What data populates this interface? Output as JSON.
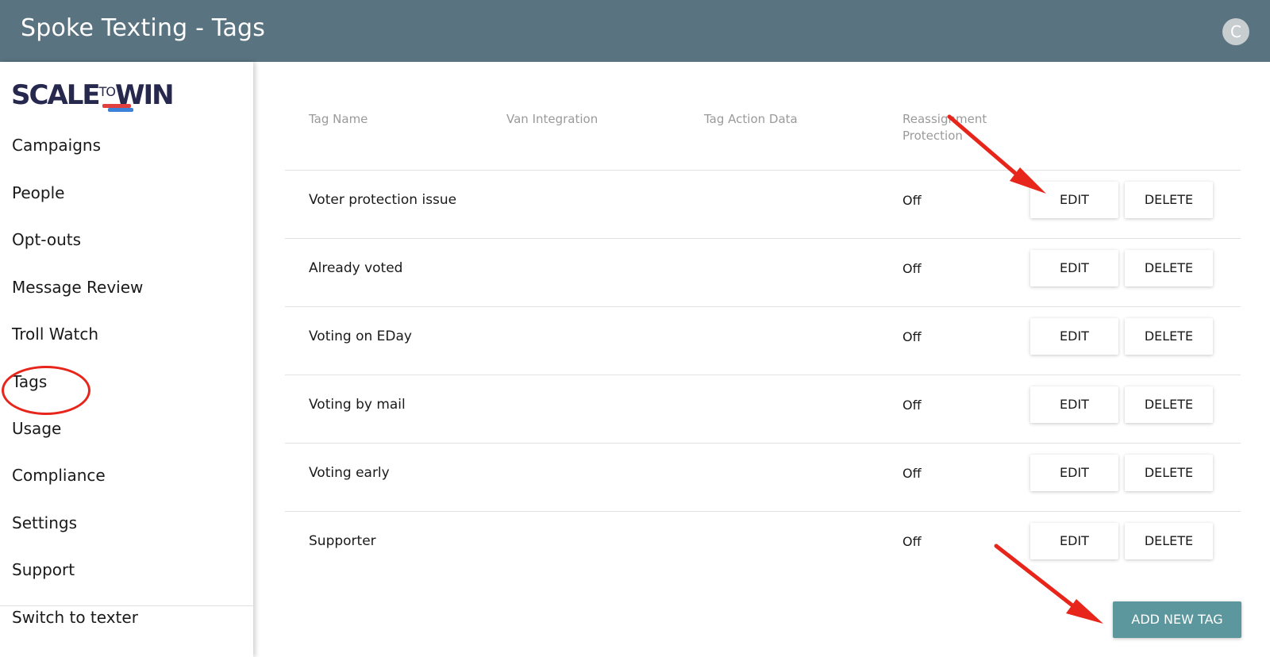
{
  "app": {
    "title": "Spoke Texting - Tags",
    "avatar_letter": "C"
  },
  "logo": {
    "text_left": "SCALE",
    "text_mid": "TO",
    "text_right": "WIN"
  },
  "sidebar": {
    "items": [
      {
        "label": "Campaigns"
      },
      {
        "label": "People"
      },
      {
        "label": "Opt-outs"
      },
      {
        "label": "Message Review"
      },
      {
        "label": "Troll Watch"
      },
      {
        "label": "Tags"
      },
      {
        "label": "Usage"
      },
      {
        "label": "Compliance"
      },
      {
        "label": "Settings"
      },
      {
        "label": "Support"
      },
      {
        "label": "Switch to texter"
      }
    ]
  },
  "table": {
    "headers": [
      "Tag Name",
      "Van Integration",
      "Tag Action Data",
      "Reassignment Protection"
    ],
    "header_reassign_lines": [
      "Reassignment",
      "Protection"
    ],
    "rows": [
      {
        "name": "Voter protection issue",
        "protection": "Off"
      },
      {
        "name": "Already voted",
        "protection": "Off"
      },
      {
        "name": "Voting on EDay",
        "protection": "Off"
      },
      {
        "name": "Voting by mail",
        "protection": "Off"
      },
      {
        "name": "Voting early",
        "protection": "Off"
      },
      {
        "name": "Supporter",
        "protection": "Off"
      }
    ],
    "edit_label": "EDIT",
    "delete_label": "DELETE"
  },
  "add_button": {
    "label": "ADD NEW TAG"
  },
  "colors": {
    "topbar": "#5a7380",
    "accent": "#5b979d",
    "annotation": "#e8251b"
  }
}
